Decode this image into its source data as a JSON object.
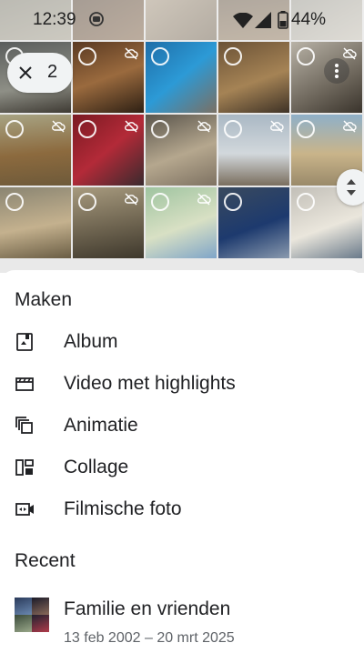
{
  "status_bar": {
    "time": "12:39",
    "battery": "44%"
  },
  "selection": {
    "count": "2"
  },
  "sheet": {
    "create_title": "Maken",
    "create_items": [
      {
        "label": "Album",
        "icon": "album-icon"
      },
      {
        "label": "Video met highlights",
        "icon": "movie-clapper-icon"
      },
      {
        "label": "Animatie",
        "icon": "animation-icon"
      },
      {
        "label": "Collage",
        "icon": "collage-icon"
      },
      {
        "label": "Filmische foto",
        "icon": "cinematic-photo-icon"
      }
    ],
    "recent_title": "Recent",
    "recent_items": [
      {
        "title": "Familie en vrienden",
        "subtitle": "13 feb 2002 – 20 mrt 2025"
      }
    ]
  },
  "colors": {
    "text": "#202124",
    "secondary_text": "#5f6368",
    "chip_bg": "#f1f3f4"
  }
}
